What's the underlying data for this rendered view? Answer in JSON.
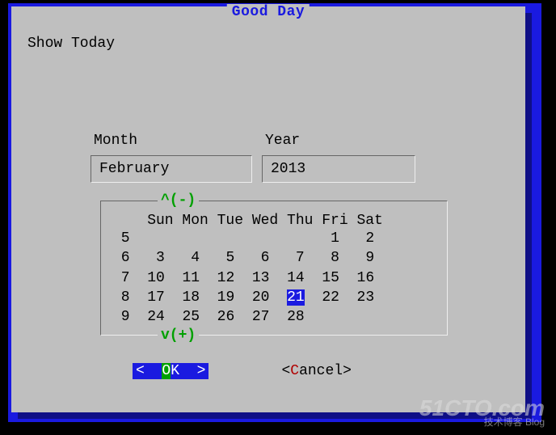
{
  "dialog": {
    "title": "Good Day",
    "label": "Show Today"
  },
  "fields": {
    "month_label": "Month",
    "month_value": "February",
    "year_label": "Year",
    "year_value": "2013"
  },
  "calendar": {
    "scroll_up": "^(-)",
    "scroll_down": "v(+)",
    "day_headers": [
      "Sun",
      "Mon",
      "Tue",
      "Wed",
      "Thu",
      "Fri",
      "Sat"
    ],
    "weeks": [
      {
        "num": "5",
        "days": [
          "",
          "",
          "",
          "",
          "",
          "1",
          "2"
        ]
      },
      {
        "num": "6",
        "days": [
          "3",
          "4",
          "5",
          "6",
          "7",
          "8",
          "9"
        ]
      },
      {
        "num": "7",
        "days": [
          "10",
          "11",
          "12",
          "13",
          "14",
          "15",
          "16"
        ]
      },
      {
        "num": "8",
        "days": [
          "17",
          "18",
          "19",
          "20",
          "21",
          "22",
          "23"
        ]
      },
      {
        "num": "9",
        "days": [
          "24",
          "25",
          "26",
          "27",
          "28",
          "",
          ""
        ]
      }
    ],
    "selected_day": "21"
  },
  "buttons": {
    "ok": {
      "left": "<  ",
      "hot": "O",
      "rest": "K  >"
    },
    "cancel": {
      "left": "<",
      "hot": "C",
      "rest": "ancel>"
    }
  },
  "watermark": {
    "main": "51CTO.com",
    "sub": "技术博客 Blog"
  }
}
